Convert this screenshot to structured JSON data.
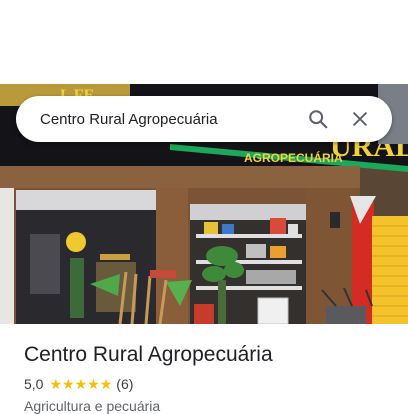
{
  "search": {
    "query": "Centro Rural Agropecuária"
  },
  "photo": {
    "sign_text": "AGROPECUÁRIA",
    "sign_text_large": "URAL",
    "sign_text_left": "L FE"
  },
  "place": {
    "title": "Centro Rural Agropecuária",
    "rating": "5,0",
    "star_count": 5,
    "reviews": "(6)",
    "category": "Agricultura e pecuária"
  },
  "colors": {
    "star": "#fbbc04",
    "sign_yellow": "#f2d23a",
    "sign_green": "#1ca85a",
    "storefront_brown": "#7a5434",
    "wall_red": "#d42c22",
    "shutter_yellow": "#f4c22a"
  }
}
